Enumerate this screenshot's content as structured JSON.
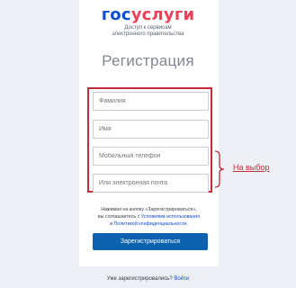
{
  "logo": {
    "part_blue": "гос",
    "part_red": "услуги"
  },
  "tagline": {
    "line1": "Доступ к сервисам",
    "line2": "электронного правительства"
  },
  "form": {
    "title": "Регистрация",
    "fields": [
      {
        "placeholder": "Фамилия"
      },
      {
        "placeholder": "Имя"
      },
      {
        "placeholder": "Мобильный телефон"
      },
      {
        "placeholder": "Или электронная почта"
      }
    ],
    "consent": {
      "line1": "Нажимая на кнопку «Зарегистрироваться»,",
      "line2_prefix": "вы соглашаетесь с ",
      "terms_link": "Условиями использования",
      "line3_conj": "и ",
      "privacy_link": "Политикой конфиденциальности",
      "line3_end": "."
    },
    "submit_label": "Зарегистрироваться"
  },
  "annotation": {
    "label": "На выбор",
    "color": "#c12e3a"
  },
  "footer": {
    "question": "Уже зарегистрировались?",
    "login_link": "Войти"
  },
  "colors": {
    "brand_blue": "#0d4cd3",
    "brand_red": "#ee3f58",
    "button": "#0d62b0",
    "background": "#eceff3"
  }
}
